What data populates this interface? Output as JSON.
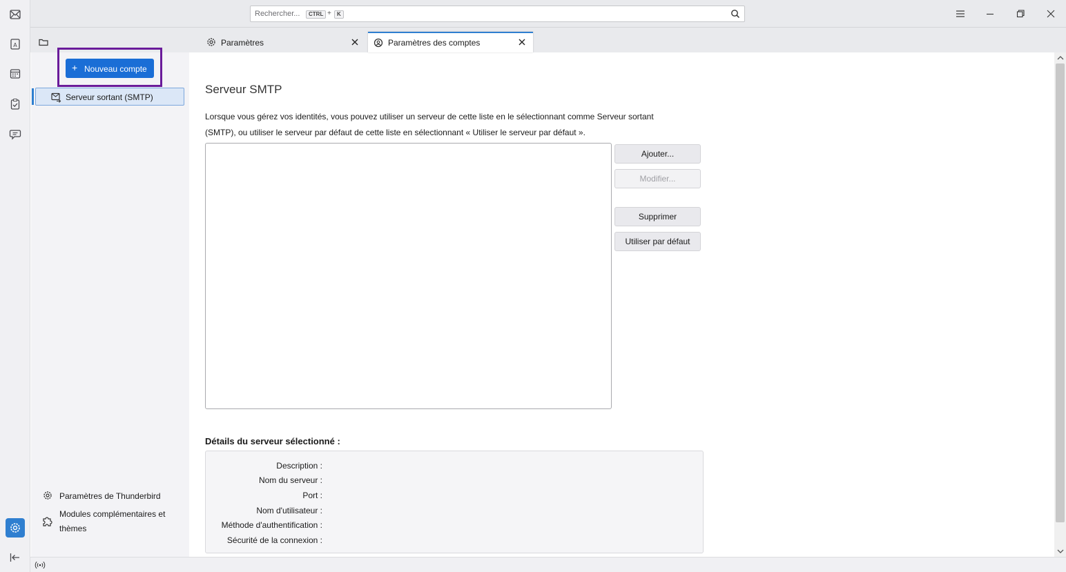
{
  "search": {
    "placeholder": "Rechercher...",
    "shortcut_mod": "CTRL",
    "shortcut_plus": "+",
    "shortcut_key": "K"
  },
  "tabs": [
    {
      "label": "Paramètres",
      "icon": "gear-icon"
    },
    {
      "label": "Paramètres des comptes",
      "icon": "account-settings-icon"
    }
  ],
  "sidebar": {
    "new_account_label": "Nouveau compte",
    "new_account_plus": "+",
    "smtp_item": "Serveur sortant (SMTP)",
    "thunderbird_settings": "Paramètres de Thunderbird",
    "addons_line1": "Modules complémentaires et",
    "addons_line2": "thèmes"
  },
  "main": {
    "heading": "Serveur SMTP",
    "description_line1": "Lorsque vous gérez vos identités, vous pouvez utiliser un serveur de cette liste en le sélectionnant comme Serveur sortant",
    "description_line2": "(SMTP), ou utiliser le serveur par défaut de cette liste en sélectionnant « Utiliser le serveur par défaut ».",
    "buttons": {
      "add": "Ajouter...",
      "edit": "Modifier...",
      "delete": "Supprimer",
      "set_default": "Utiliser par défaut"
    },
    "details_title": "Détails du serveur sélectionné :",
    "details_labels": {
      "description": "Description :",
      "server_name": "Nom du serveur :",
      "port": "Port :",
      "username": "Nom d'utilisateur :",
      "auth_method": "Méthode d'authentification :",
      "security": "Sécurité de la connexion :"
    }
  },
  "colors": {
    "accent": "#1a6ed6",
    "highlight_box": "#6a1b9a"
  }
}
